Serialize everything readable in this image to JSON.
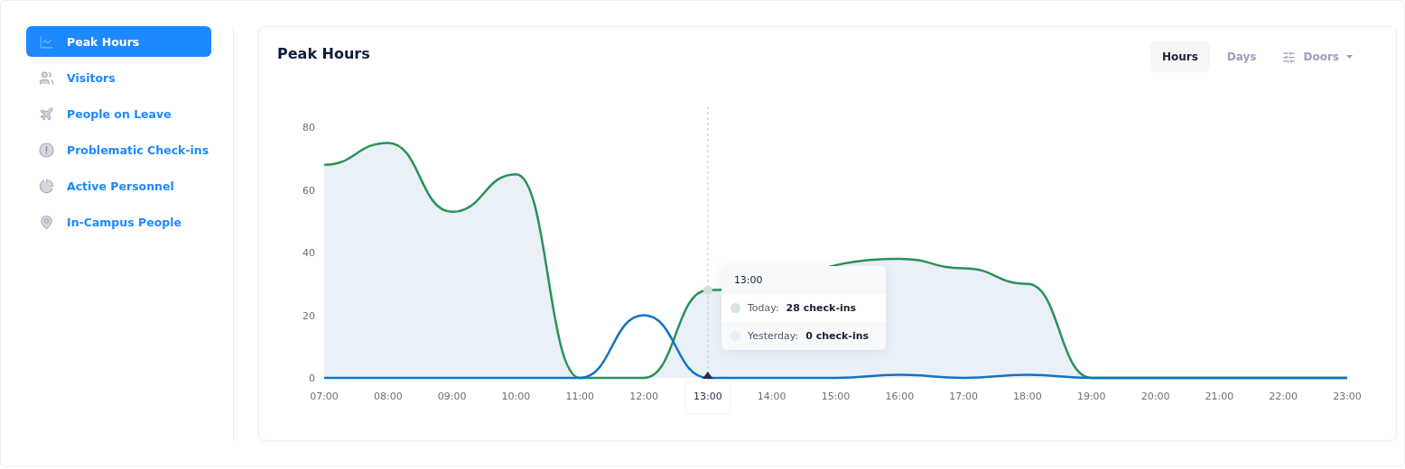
{
  "sidebar": {
    "items": [
      {
        "label": "Peak Hours",
        "kind": "chart",
        "selected": true
      },
      {
        "label": "Visitors",
        "kind": "people",
        "selected": false
      },
      {
        "label": "People on Leave",
        "kind": "plane",
        "selected": false
      },
      {
        "label": "Problematic Check-ins",
        "kind": "alert",
        "selected": false
      },
      {
        "label": "Active Personnel",
        "kind": "pie",
        "selected": false
      },
      {
        "label": "In-Campus People",
        "kind": "pin",
        "selected": false
      }
    ]
  },
  "panel": {
    "title": "Peak Hours",
    "toggles": [
      {
        "label": "Hours",
        "selected": true
      },
      {
        "label": "Days",
        "selected": false
      }
    ],
    "filter": {
      "label": "Doors"
    },
    "chart_data": {
      "type": "line",
      "categories": [
        "07:00",
        "08:00",
        "09:00",
        "10:00",
        "11:00",
        "12:00",
        "13:00",
        "14:00",
        "15:00",
        "16:00",
        "17:00",
        "18:00",
        "19:00",
        "20:00",
        "21:00",
        "22:00",
        "23:00"
      ],
      "ylim": [
        0,
        80
      ],
      "yticks": [
        0,
        20,
        40,
        60,
        80
      ],
      "series": [
        {
          "color": "#2a9158",
          "values": [
            68,
            75,
            53,
            65,
            0,
            0,
            28,
            null,
            null,
            38,
            35,
            30,
            0,
            0,
            0,
            0,
            0
          ]
        },
        {
          "color": "#1273c4",
          "values": [
            0,
            0,
            0,
            0,
            0,
            20,
            0,
            0,
            0,
            1,
            0,
            1,
            0,
            0,
            0,
            0,
            0
          ]
        }
      ]
    },
    "tooltip": {
      "title": "13:00",
      "rows": [
        {
          "label": "Today:",
          "value": "28 check-ins",
          "color": "#d3e6e1"
        },
        {
          "label": "Yesterday:",
          "value": "0 check-ins",
          "color": "#e1f0fa"
        }
      ]
    }
  }
}
